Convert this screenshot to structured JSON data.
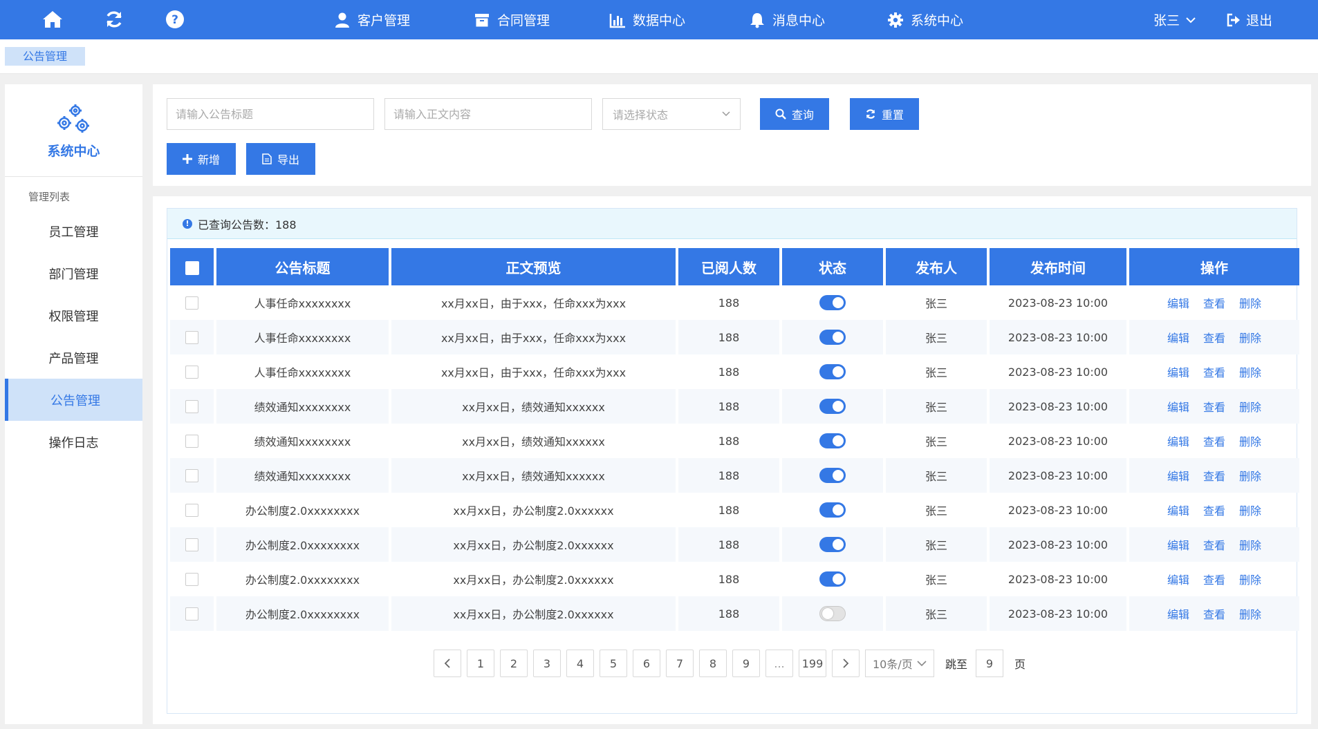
{
  "colors": {
    "primary": "#3478e5",
    "light": "#cfe2f9"
  },
  "topbar": {
    "left_icons": [
      "home-icon",
      "refresh-icon",
      "help-icon"
    ],
    "nav": [
      {
        "label": "客户管理",
        "icon": "user-icon"
      },
      {
        "label": "合同管理",
        "icon": "archive-icon"
      },
      {
        "label": "数据中心",
        "icon": "bar-chart-icon"
      },
      {
        "label": "消息中心",
        "icon": "bell-icon"
      },
      {
        "label": "系统中心",
        "icon": "gear-icon"
      }
    ],
    "user": "张三",
    "logout": "退出"
  },
  "tabs": [
    {
      "label": "公告管理"
    }
  ],
  "sidebar": {
    "title": "系统中心",
    "section": "管理列表",
    "items": [
      {
        "label": "员工管理"
      },
      {
        "label": "部门管理"
      },
      {
        "label": "权限管理"
      },
      {
        "label": "产品管理"
      },
      {
        "label": "公告管理"
      },
      {
        "label": "操作日志"
      }
    ],
    "active_index": 4
  },
  "search": {
    "title_placeholder": "请输入公告标题",
    "content_placeholder": "请输入正文内容",
    "status_placeholder": "请选择状态",
    "query_label": "查询",
    "reset_label": "重置",
    "add_label": "新增",
    "export_label": "导出"
  },
  "info": {
    "text": "已查询公告数：188"
  },
  "table": {
    "headers": [
      "公告标题",
      "正文预览",
      "已阅人数",
      "状态",
      "发布人",
      "发布时间",
      "操作"
    ],
    "actions": [
      "编辑",
      "查看",
      "删除"
    ],
    "rows": [
      {
        "title": "人事任命xxxxxxxx",
        "preview": "xx月xx日，由于xxx，任命xxx为xxx",
        "read": "188",
        "status": true,
        "publisher": "张三",
        "time": "2023-08-23 10:00"
      },
      {
        "title": "人事任命xxxxxxxx",
        "preview": "xx月xx日，由于xxx，任命xxx为xxx",
        "read": "188",
        "status": true,
        "publisher": "张三",
        "time": "2023-08-23 10:00"
      },
      {
        "title": "人事任命xxxxxxxx",
        "preview": "xx月xx日，由于xxx，任命xxx为xxx",
        "read": "188",
        "status": true,
        "publisher": "张三",
        "time": "2023-08-23 10:00"
      },
      {
        "title": "绩效通知xxxxxxxx",
        "preview": "xx月xx日，绩效通知xxxxxx",
        "read": "188",
        "status": true,
        "publisher": "张三",
        "time": "2023-08-23 10:00"
      },
      {
        "title": "绩效通知xxxxxxxx",
        "preview": "xx月xx日，绩效通知xxxxxx",
        "read": "188",
        "status": true,
        "publisher": "张三",
        "time": "2023-08-23 10:00"
      },
      {
        "title": "绩效通知xxxxxxxx",
        "preview": "xx月xx日，绩效通知xxxxxx",
        "read": "188",
        "status": true,
        "publisher": "张三",
        "time": "2023-08-23 10:00"
      },
      {
        "title": "办公制度2.0xxxxxxxx",
        "preview": "xx月xx日，办公制度2.0xxxxxx",
        "read": "188",
        "status": true,
        "publisher": "张三",
        "time": "2023-08-23 10:00"
      },
      {
        "title": "办公制度2.0xxxxxxxx",
        "preview": "xx月xx日，办公制度2.0xxxxxx",
        "read": "188",
        "status": true,
        "publisher": "张三",
        "time": "2023-08-23 10:00"
      },
      {
        "title": "办公制度2.0xxxxxxxx",
        "preview": "xx月xx日，办公制度2.0xxxxxx",
        "read": "188",
        "status": true,
        "publisher": "张三",
        "time": "2023-08-23 10:00"
      },
      {
        "title": "办公制度2.0xxxxxxxx",
        "preview": "xx月xx日，办公制度2.0xxxxxx",
        "read": "188",
        "status": false,
        "publisher": "张三",
        "time": "2023-08-23 10:00"
      }
    ]
  },
  "pagination": {
    "pages": [
      "1",
      "2",
      "3",
      "4",
      "5",
      "6",
      "7",
      "8",
      "9",
      "...",
      "199"
    ],
    "page_size": "10条/页",
    "jump_label": "跳至",
    "jump_value": "9",
    "jump_suffix": "页"
  }
}
